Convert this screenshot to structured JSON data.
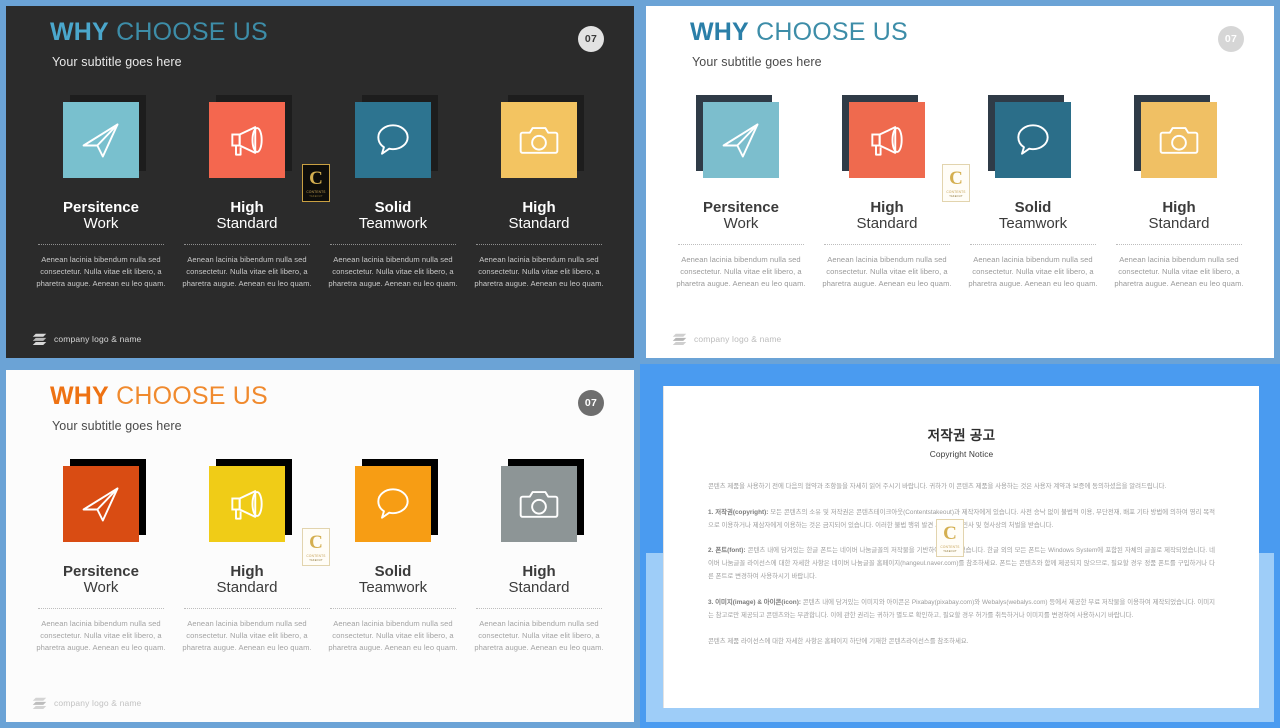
{
  "slides": [
    {
      "id": "dark",
      "theme_label": "dark-theme-slide",
      "title_bold": "WHY",
      "title_rest": " CHOOSE US",
      "subtitle": "Your subtitle goes here",
      "page_number": "07",
      "footer": "company logo & name",
      "watermark": {
        "letter": "C",
        "line1": "CONTENTS",
        "line2": "TAKEOUT"
      },
      "cards": [
        {
          "icon": "paper-plane-icon",
          "tile_color": "#79c0ce",
          "heading_1": "Persitence",
          "heading_2": "Work",
          "body": "Aenean lacinia bibendum nulla sed consectetur. Nulla vitae elit libero, a pharetra augue. Aenean eu leo quam."
        },
        {
          "icon": "megaphone-icon",
          "tile_color": "#f4674f",
          "heading_1": "High",
          "heading_2": "Standard",
          "body": "Aenean lacinia bibendum nulla sed consectetur. Nulla vitae elit libero, a pharetra augue. Aenean eu leo quam."
        },
        {
          "icon": "speech-bubble-icon",
          "tile_color": "#2d7490",
          "heading_1": "Solid",
          "heading_2": "Teamwork",
          "body": "Aenean lacinia bibendum nulla sed consectetur. Nulla vitae elit libero, a pharetra augue. Aenean eu leo quam."
        },
        {
          "icon": "camera-icon",
          "tile_color": "#f3c461",
          "heading_1": "High",
          "heading_2": "Standard",
          "body": "Aenean lacinia bibendum nulla sed consectetur. Nulla vitae elit libero, a pharetra augue. Aenean eu leo quam."
        }
      ]
    },
    {
      "id": "light",
      "theme_label": "light-theme-slide",
      "title_bold": "WHY",
      "title_rest": " CHOOSE US",
      "subtitle": "Your subtitle goes here",
      "page_number": "07",
      "footer": "company logo & name",
      "watermark": {
        "letter": "C",
        "line1": "CONTENTS",
        "line2": "TAKEOUT"
      },
      "cards": [
        {
          "icon": "paper-plane-icon",
          "tile_color": "#7cbecd",
          "heading_1": "Persitence",
          "heading_2": "Work",
          "body": "Aenean lacinia bibendum nulla sed consectetur. Nulla vitae elit libero, a pharetra augue. Aenean eu leo quam."
        },
        {
          "icon": "megaphone-icon",
          "tile_color": "#ef6a4e",
          "heading_1": "High",
          "heading_2": "Standard",
          "body": "Aenean lacinia bibendum nulla sed consectetur. Nulla vitae elit libero, a pharetra augue. Aenean eu leo quam."
        },
        {
          "icon": "speech-bubble-icon",
          "tile_color": "#2b6e89",
          "heading_1": "Solid",
          "heading_2": "Teamwork",
          "body": "Aenean lacinia bibendum nulla sed consectetur. Nulla vitae elit libero, a pharetra augue. Aenean eu leo quam."
        },
        {
          "icon": "camera-icon",
          "tile_color": "#f0c064",
          "heading_1": "High",
          "heading_2": "Standard",
          "body": "Aenean lacinia bibendum nulla sed consectetur. Nulla vitae elit libero, a pharetra augue. Aenean eu leo quam."
        }
      ]
    },
    {
      "id": "orange",
      "theme_label": "orange-theme-slide",
      "title_bold": "WHY",
      "title_rest": " CHOOSE US",
      "subtitle": "Your subtitle goes here",
      "page_number": "07",
      "footer": "company logo & name",
      "watermark": {
        "letter": "C",
        "line1": "CONTENTS",
        "line2": "TAKEOUT"
      },
      "cards": [
        {
          "icon": "paper-plane-icon",
          "tile_color": "#d94c13",
          "heading_1": "Persitence",
          "heading_2": "Work",
          "body": "Aenean lacinia bibendum nulla sed consectetur. Nulla vitae elit libero, a pharetra augue. Aenean eu leo quam."
        },
        {
          "icon": "megaphone-icon",
          "tile_color": "#f0cc17",
          "heading_1": "High",
          "heading_2": "Standard",
          "body": "Aenean lacinia bibendum nulla sed consectetur. Nulla vitae elit libero, a pharetra augue. Aenean eu leo quam."
        },
        {
          "icon": "speech-bubble-icon",
          "tile_color": "#f79d14",
          "heading_1": "Solid",
          "heading_2": "Teamwork",
          "body": "Aenean lacinia bibendum nulla sed consectetur. Nulla vitae elit libero, a pharetra augue. Aenean eu leo quam."
        },
        {
          "icon": "camera-icon",
          "tile_color": "#8d9596",
          "heading_1": "High",
          "heading_2": "Standard",
          "body": "Aenean lacinia bibendum nulla sed consectetur. Nulla vitae elit libero, a pharetra augue. Aenean eu leo quam."
        }
      ]
    }
  ],
  "notice": {
    "title_ko": "저작권 공고",
    "title_en": "Copyright Notice",
    "watermark": {
      "letter": "C",
      "line1": "CONTENTS",
      "line2": "TAKEOUT"
    },
    "paragraphs": [
      {
        "lead": "",
        "text": "콘텐츠 제품을 사용하기 전에 다음의 협약과 조항들을 자세히 읽어 주시기 바랍니다. 귀하가 이 콘텐츠 제품을 사용하는 것은 사용자 계약과 보증에 동의하셨음을 알려드립니다."
      },
      {
        "lead": "1. 저작권(copyright):",
        "text": " 모든 콘텐츠의 소유 및 저작권은 콘텐츠테이크아웃(Contentstakeout)과 제작자에게 있습니다. 사전 승낙 없이 불법적 이용, 무단전재, 배포 기타 방법에 의하여 영리 목적으로 이용하거나 제삼자에게 이용하는 것은 금지되어 있습니다. 이러한 불법 행위 발견 시 준엄한 민사 및 형사상의 처벌을 받습니다."
      },
      {
        "lead": "2. 폰트(font):",
        "text": " 콘텐츠 내에 담겨있는 한글 폰트는 네이버 나눔글꼴의 저작물을 기반하여 제작되었습니다. 한글 외의 모든 폰트는 Windows System에 포함된 자체의 글꼴로 제작되었습니다. 네이버 나눔글꼴 라이선스에 대한 자세한 사항은 네이버 나눔글꼴 홈페이지(hangeul.naver.com)를 참조하세요. 폰트는 콘텐츠와 함께 제공되지 않으므로, 필요할 경우 정품 폰트를 구입하거나 다른 폰트로 변경하여 사용하시기 바랍니다."
      },
      {
        "lead": "3. 이미지(image) & 아이콘(icon):",
        "text": " 콘텐츠 내에 담겨있는 이미지와 아이콘은 Pixabay(pixabay.com)와 Webalys(webalys.com) 등에서 제공한 무료 저작물을 이용하여 제작되었습니다. 이미지는 참고로만 제공되고 콘텐츠와는 무관합니다. 이에 관한 권리는 귀하가 별도로 확인하고, 필요할 경우 허가를 취득하거나 이미지를 변경하여 사용하시기 바랍니다."
      },
      {
        "lead": "",
        "text": "콘텐츠 제품 라이선스에 대한 자세한 사항은 홈페이지 하단에 기재한 콘텐츠라이선스를 참조하세요."
      }
    ]
  }
}
